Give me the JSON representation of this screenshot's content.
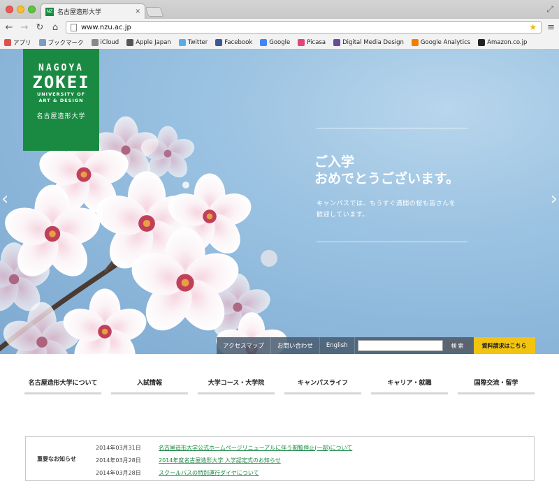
{
  "browser": {
    "tab_title": "名古屋造形大学",
    "url": "www.nzu.ac.jp",
    "bookmarks": [
      {
        "label": "アプリ",
        "color": "#d9534f"
      },
      {
        "label": "ブックマーク",
        "color": "#7a9cc6"
      },
      {
        "label": "iCloud",
        "color": "#888888"
      },
      {
        "label": "Apple Japan",
        "color": "#555555"
      },
      {
        "label": "Twitter",
        "color": "#55acee"
      },
      {
        "label": "Facebook",
        "color": "#3b5998"
      },
      {
        "label": "Google",
        "color": "#4285f4"
      },
      {
        "label": "Picasa",
        "color": "#e0457b"
      },
      {
        "label": "Digital Media Design",
        "color": "#6b4a9b"
      },
      {
        "label": "Google Analytics",
        "color": "#f57c00"
      },
      {
        "label": "Amazon.co.jp",
        "color": "#222222"
      }
    ]
  },
  "logo": {
    "line1": "NAGOYA",
    "line2": "ZOKEI",
    "line3a": "UNIVERSITY OF",
    "line3b": "ART & DESIGN",
    "line4": "名古屋造形大学",
    "bg_color": "#1a8a43"
  },
  "hero": {
    "title_line1": "ご入学",
    "title_line2": "おめでとうございます。",
    "body_line1": "キャンパスでは、もうすぐ満開の桜も皆さんを",
    "body_line2": "歓迎しています。",
    "prev_arrow": "‹",
    "next_arrow": "›"
  },
  "utility": {
    "access_label": "アクセスマップ",
    "contact_label": "お問い合わせ",
    "english_label": "English",
    "search_placeholder": "",
    "search_button": "検索",
    "request_button": "資料請求はこちら",
    "request_color": "#f2c40f"
  },
  "gnav": [
    "名古屋造形大学について",
    "入試情報",
    "大学コース・大学院",
    "キャンパスライフ",
    "キャリア・就職",
    "国際交流・留学"
  ],
  "news": {
    "label": "重要なお知らせ",
    "items": [
      {
        "date": "2014年03月31日",
        "title": "名古屋造形大学公式ホームページリニューアルに伴う閲覧停止(一部)について"
      },
      {
        "date": "2014年03月28日",
        "title": "2014年度名古屋造形大学 入学認定式のお知らせ"
      },
      {
        "date": "2014年03月28日",
        "title": "スクールバスの特別運行ダイヤについて"
      }
    ],
    "link_color": "#1a8a43"
  }
}
